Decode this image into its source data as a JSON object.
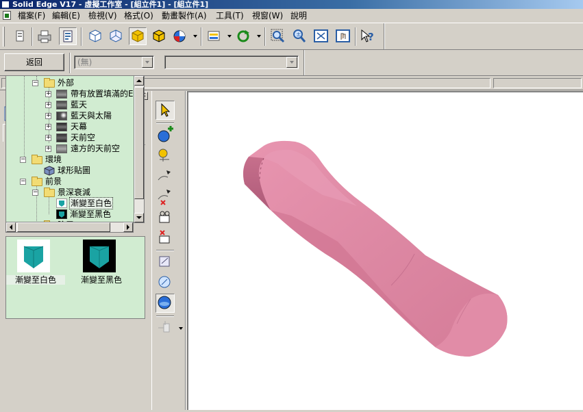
{
  "window": {
    "title": "Solid Edge V17 - 虛擬工作室 - [組立件1] - [組立件1]"
  },
  "menu": {
    "items": [
      "檔案(F)",
      "編輯(E)",
      "檢視(V)",
      "格式(O)",
      "動畫製作(A)",
      "工具(T)",
      "視窗(W)",
      "說明"
    ]
  },
  "toolbar": {
    "icons": [
      "print-preview-icon",
      "print-icon",
      "properties-icon",
      "view-iso-icon",
      "view-front-icon",
      "shaded-icon",
      "shaded-edges-icon",
      "render-icon",
      "render-dropdown",
      "scene-icon",
      "scene-dropdown",
      "rotate-icon",
      "rotate-dropdown",
      "zoom-area-icon",
      "zoom-icon",
      "fit-icon",
      "pan-icon",
      "help-icon"
    ]
  },
  "nav": {
    "back_label": "返回",
    "combo1_value": "(無)",
    "combo2_value": ""
  },
  "tree": {
    "items": [
      {
        "label": "外部",
        "type": "folder",
        "expanded": true
      },
      {
        "label": "帶有放置填滿的E",
        "type": "thumb"
      },
      {
        "label": "藍天",
        "type": "thumb"
      },
      {
        "label": "藍天與太陽",
        "type": "thumb"
      },
      {
        "label": "天幕",
        "type": "thumb"
      },
      {
        "label": "天前空",
        "type": "thumb"
      },
      {
        "label": "遠方的天前空",
        "type": "thumb"
      },
      {
        "label": "環境",
        "type": "folder",
        "expanded": true
      },
      {
        "label": "球形貼圖",
        "type": "cube"
      },
      {
        "label": "前景",
        "type": "folder",
        "expanded": true
      },
      {
        "label": "景深衰減",
        "type": "folder",
        "expanded": true
      },
      {
        "label": "漸變至白色",
        "type": "fade-white",
        "selected": true
      },
      {
        "label": "漸變至黑色",
        "type": "fade-black"
      },
      {
        "label": "陰霧",
        "type": "folder"
      }
    ]
  },
  "preview": {
    "items": [
      {
        "label": "漸變至白色",
        "bg": "#ffffff",
        "selected": true
      },
      {
        "label": "漸變至黑色",
        "bg": "#000000",
        "selected": false
      }
    ]
  },
  "colors": {
    "panel_bg": "#d1ecd1",
    "model": "#e08aa5",
    "cube_teal": "#1aa3a3"
  }
}
